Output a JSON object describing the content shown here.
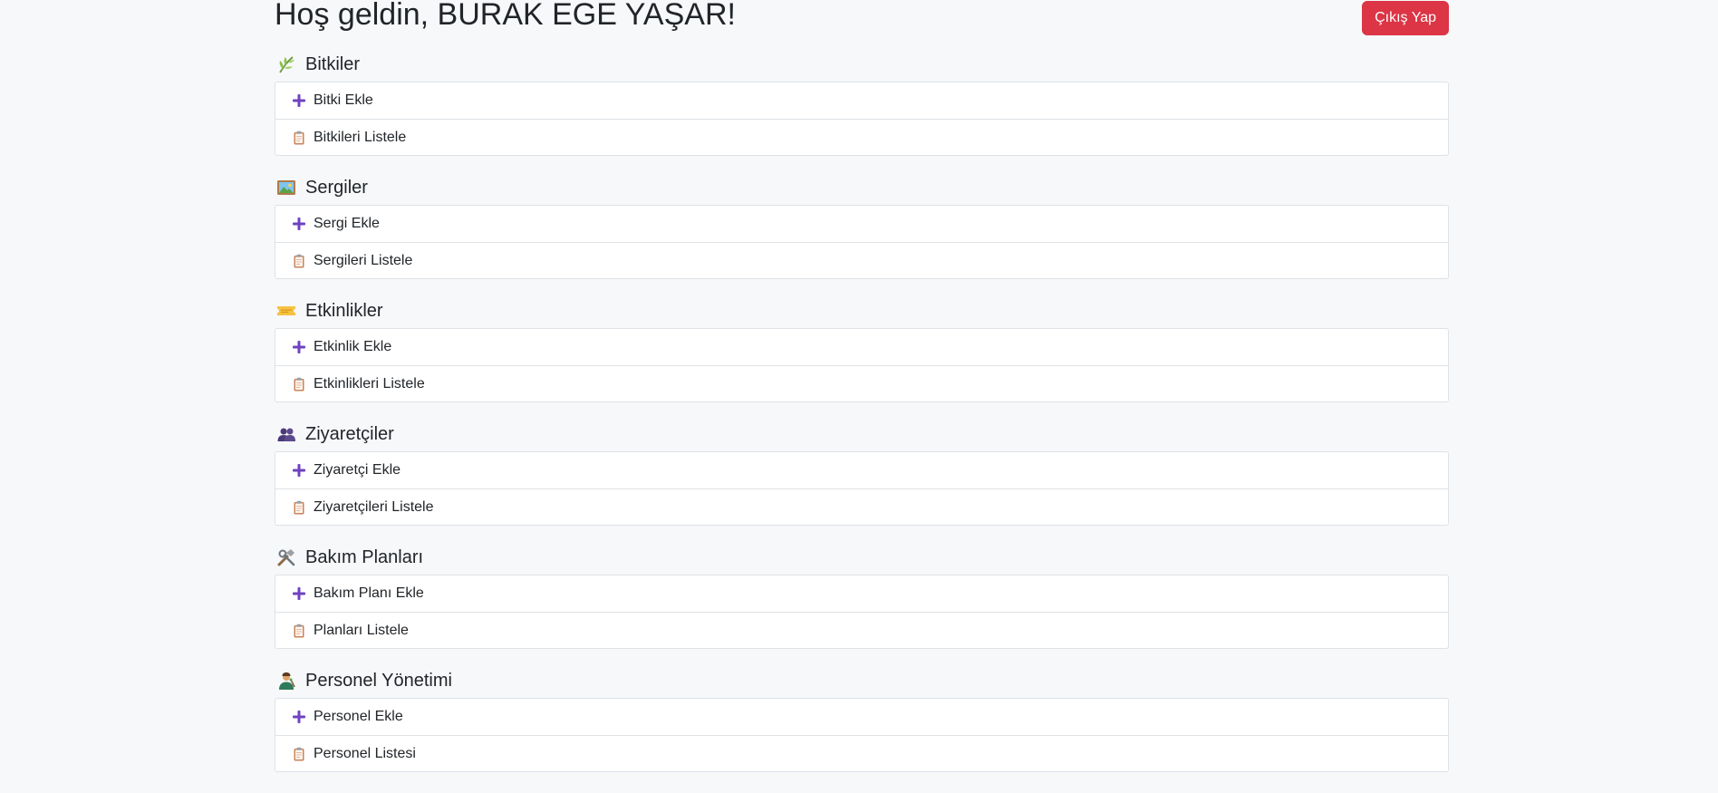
{
  "header": {
    "welcome": "Hoş geldin, BURAK EGE YAŞAR!",
    "logout_label": "Çıkış Yap"
  },
  "colors": {
    "logout_bg": "#dc3545",
    "plus_icon": "#6f42c1",
    "border": "#dee2e6",
    "page_bg": "#f7f8fa"
  },
  "sections": [
    {
      "title": "Bitkiler",
      "icon": "herb-icon",
      "items": [
        {
          "label": "Bitki Ekle",
          "icon": "plus-icon"
        },
        {
          "label": "Bitkileri Listele",
          "icon": "clipboard-icon"
        }
      ]
    },
    {
      "title": "Sergiler",
      "icon": "framed-picture-icon",
      "items": [
        {
          "label": "Sergi Ekle",
          "icon": "plus-icon"
        },
        {
          "label": "Sergileri Listele",
          "icon": "clipboard-icon"
        }
      ]
    },
    {
      "title": "Etkinlikler",
      "icon": "ticket-icon",
      "items": [
        {
          "label": "Etkinlik Ekle",
          "icon": "plus-icon"
        },
        {
          "label": "Etkinlikleri Listele",
          "icon": "clipboard-icon"
        }
      ]
    },
    {
      "title": "Ziyaretçiler",
      "icon": "people-icon",
      "items": [
        {
          "label": "Ziyaretçi Ekle",
          "icon": "plus-icon"
        },
        {
          "label": "Ziyaretçileri Listele",
          "icon": "clipboard-icon"
        }
      ]
    },
    {
      "title": "Bakım Planları",
      "icon": "tools-icon",
      "items": [
        {
          "label": "Bakım Planı Ekle",
          "icon": "plus-icon"
        },
        {
          "label": "Planları Listele",
          "icon": "clipboard-icon"
        }
      ]
    },
    {
      "title": "Personel Yönetimi",
      "icon": "farmer-icon",
      "items": [
        {
          "label": "Personel Ekle",
          "icon": "plus-icon"
        },
        {
          "label": "Personel Listesi",
          "icon": "clipboard-icon"
        }
      ]
    }
  ]
}
